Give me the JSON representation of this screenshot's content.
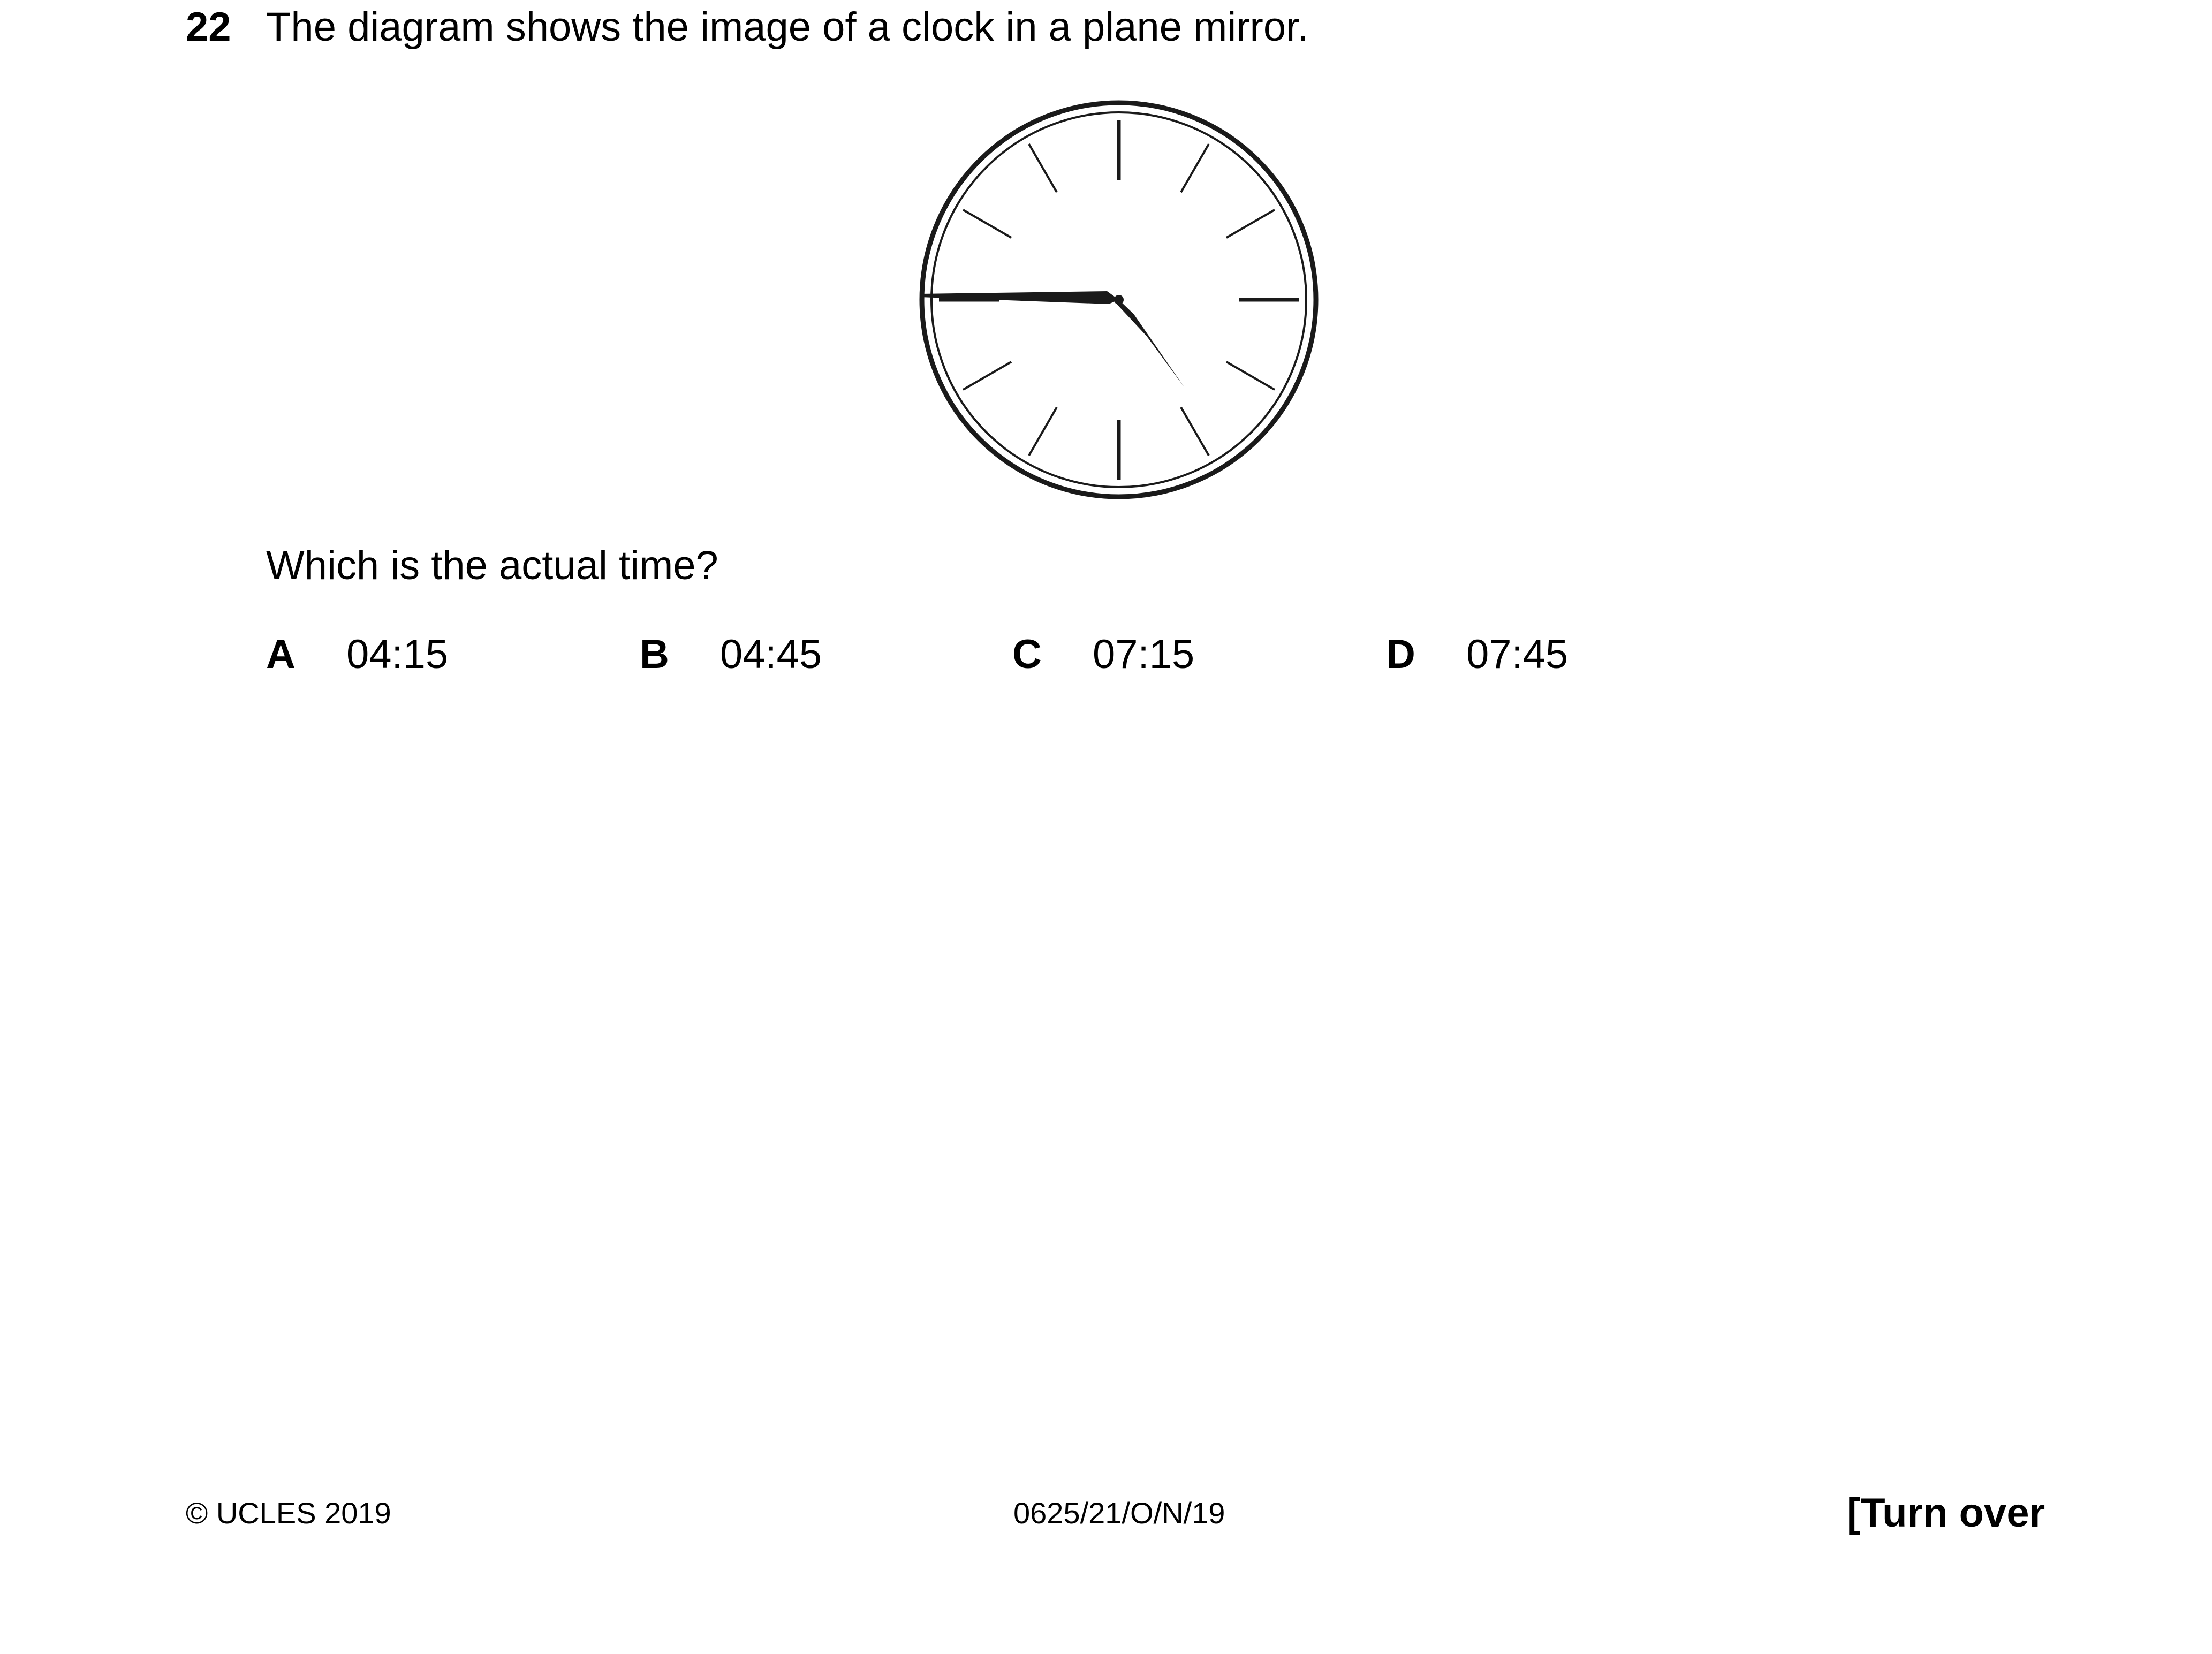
{
  "question": {
    "number": "22",
    "stem": "The diagram shows the image of a clock in a plane mirror.",
    "prompt": "Which is the actual time?"
  },
  "clock_figure": {
    "description_icon": "mirror-image-clock",
    "hour_hand_points_to": 5,
    "minute_hand_points_to": 9
  },
  "options": [
    {
      "letter": "A",
      "text": "04:15"
    },
    {
      "letter": "B",
      "text": "04:45"
    },
    {
      "letter": "C",
      "text": "07:15"
    },
    {
      "letter": "D",
      "text": "07:45"
    }
  ],
  "footer": {
    "copyright": "© UCLES 2019",
    "code": "0625/21/O/N/19",
    "turn_over": "[Turn over"
  }
}
